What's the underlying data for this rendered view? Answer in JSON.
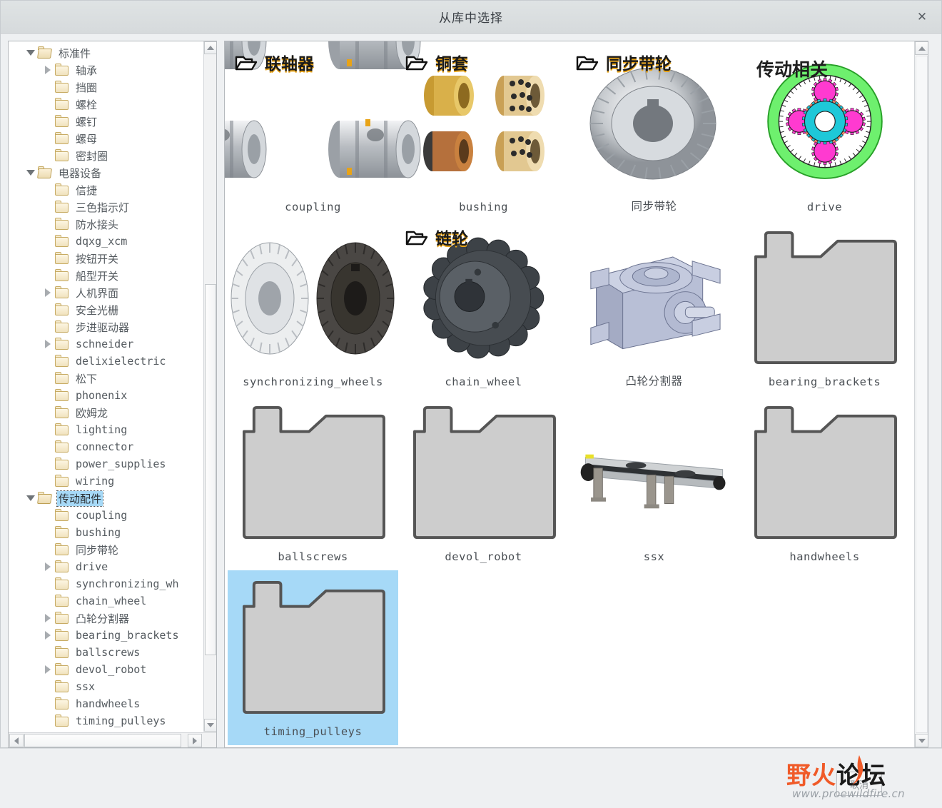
{
  "window": {
    "title": "从库中选择",
    "close_label": "✕"
  },
  "tree": {
    "items": [
      {
        "label": "标准件",
        "indent": 0,
        "twisty": "down",
        "folder": "open",
        "selected": false
      },
      {
        "label": "轴承",
        "indent": 1,
        "twisty": "right",
        "folder": "closed",
        "selected": false
      },
      {
        "label": "挡圈",
        "indent": 1,
        "twisty": "none",
        "folder": "closed",
        "selected": false
      },
      {
        "label": "螺栓",
        "indent": 1,
        "twisty": "none",
        "folder": "closed",
        "selected": false
      },
      {
        "label": "螺钉",
        "indent": 1,
        "twisty": "none",
        "folder": "closed",
        "selected": false
      },
      {
        "label": "螺母",
        "indent": 1,
        "twisty": "none",
        "folder": "closed",
        "selected": false
      },
      {
        "label": "密封圈",
        "indent": 1,
        "twisty": "none",
        "folder": "closed",
        "selected": false
      },
      {
        "label": "电器设备",
        "indent": 0,
        "twisty": "down",
        "folder": "open",
        "selected": false
      },
      {
        "label": "信捷",
        "indent": 1,
        "twisty": "none",
        "folder": "closed",
        "selected": false
      },
      {
        "label": "三色指示灯",
        "indent": 1,
        "twisty": "none",
        "folder": "closed",
        "selected": false
      },
      {
        "label": "防水接头",
        "indent": 1,
        "twisty": "none",
        "folder": "closed",
        "selected": false
      },
      {
        "label": "dqxg_xcm",
        "indent": 1,
        "twisty": "none",
        "folder": "closed",
        "selected": false
      },
      {
        "label": "按钮开关",
        "indent": 1,
        "twisty": "none",
        "folder": "closed",
        "selected": false
      },
      {
        "label": "船型开关",
        "indent": 1,
        "twisty": "none",
        "folder": "closed",
        "selected": false
      },
      {
        "label": "人机界面",
        "indent": 1,
        "twisty": "right",
        "folder": "closed",
        "selected": false
      },
      {
        "label": "安全光栅",
        "indent": 1,
        "twisty": "none",
        "folder": "closed",
        "selected": false
      },
      {
        "label": "步进驱动器",
        "indent": 1,
        "twisty": "none",
        "folder": "closed",
        "selected": false
      },
      {
        "label": "schneider",
        "indent": 1,
        "twisty": "right",
        "folder": "closed",
        "selected": false
      },
      {
        "label": "delixielectric",
        "indent": 1,
        "twisty": "none",
        "folder": "closed",
        "selected": false
      },
      {
        "label": "松下",
        "indent": 1,
        "twisty": "none",
        "folder": "closed",
        "selected": false
      },
      {
        "label": "phonenix",
        "indent": 1,
        "twisty": "none",
        "folder": "closed",
        "selected": false
      },
      {
        "label": "欧姆龙",
        "indent": 1,
        "twisty": "none",
        "folder": "closed",
        "selected": false
      },
      {
        "label": "lighting",
        "indent": 1,
        "twisty": "none",
        "folder": "closed",
        "selected": false
      },
      {
        "label": "connector",
        "indent": 1,
        "twisty": "none",
        "folder": "closed",
        "selected": false
      },
      {
        "label": "power_supplies",
        "indent": 1,
        "twisty": "none",
        "folder": "closed",
        "selected": false
      },
      {
        "label": "wiring",
        "indent": 1,
        "twisty": "none",
        "folder": "closed",
        "selected": false
      },
      {
        "label": "传动配件",
        "indent": 0,
        "twisty": "down",
        "folder": "open",
        "selected": true
      },
      {
        "label": "coupling",
        "indent": 1,
        "twisty": "none",
        "folder": "closed",
        "selected": false
      },
      {
        "label": "bushing",
        "indent": 1,
        "twisty": "none",
        "folder": "closed",
        "selected": false
      },
      {
        "label": "同步带轮",
        "indent": 1,
        "twisty": "none",
        "folder": "closed",
        "selected": false
      },
      {
        "label": "drive",
        "indent": 1,
        "twisty": "right",
        "folder": "closed",
        "selected": false
      },
      {
        "label": "synchronizing_wh",
        "indent": 1,
        "twisty": "none",
        "folder": "closed",
        "selected": false
      },
      {
        "label": "chain_wheel",
        "indent": 1,
        "twisty": "none",
        "folder": "closed",
        "selected": false
      },
      {
        "label": "凸轮分割器",
        "indent": 1,
        "twisty": "right",
        "folder": "closed",
        "selected": false
      },
      {
        "label": "bearing_brackets",
        "indent": 1,
        "twisty": "right",
        "folder": "closed",
        "selected": false
      },
      {
        "label": "ballscrews",
        "indent": 1,
        "twisty": "none",
        "folder": "closed",
        "selected": false
      },
      {
        "label": "devol_robot",
        "indent": 1,
        "twisty": "right",
        "folder": "closed",
        "selected": false
      },
      {
        "label": "ssx",
        "indent": 1,
        "twisty": "none",
        "folder": "closed",
        "selected": false
      },
      {
        "label": "handwheels",
        "indent": 1,
        "twisty": "none",
        "folder": "closed",
        "selected": false
      },
      {
        "label": "timing_pulleys",
        "indent": 1,
        "twisty": "none",
        "folder": "closed",
        "selected": false
      }
    ]
  },
  "grid": {
    "cells": [
      {
        "caption": "coupling",
        "thumb": "coupling",
        "group_header": "联轴器",
        "selected": false
      },
      {
        "caption": "bushing",
        "thumb": "bushing",
        "group_header": "铜套",
        "selected": false
      },
      {
        "caption": "同步带轮",
        "thumb": "timing-belt-pulley",
        "group_header": "同步带轮",
        "selected": false
      },
      {
        "caption": "drive",
        "thumb": "planetary-gear",
        "group_header": "",
        "overlay_title": "传动相关",
        "selected": false
      },
      {
        "caption": "synchronizing_wheels",
        "thumb": "sync-wheels",
        "group_header": "",
        "selected": false
      },
      {
        "caption": "chain_wheel",
        "thumb": "sprocket",
        "group_header": "链轮",
        "selected": false
      },
      {
        "caption": "凸轮分割器",
        "thumb": "cam-indexer",
        "group_header": "",
        "selected": false
      },
      {
        "caption": "bearing_brackets",
        "thumb": "folder-placeholder",
        "group_header": "",
        "selected": false
      },
      {
        "caption": "ballscrews",
        "thumb": "folder-placeholder",
        "group_header": "",
        "selected": false
      },
      {
        "caption": "devol_robot",
        "thumb": "folder-placeholder",
        "group_header": "",
        "selected": false
      },
      {
        "caption": "ssx",
        "thumb": "conveyor",
        "group_header": "",
        "selected": false
      },
      {
        "caption": "handwheels",
        "thumb": "folder-placeholder",
        "group_header": "",
        "selected": false
      },
      {
        "caption": "timing_pulleys",
        "thumb": "folder-placeholder",
        "group_header": "",
        "selected": true
      }
    ]
  },
  "footer": {
    "ghost_button_label": "取消",
    "watermark_brand_1": "野",
    "watermark_brand_2": "火",
    "watermark_brand_3": "论坛",
    "watermark_url": "www.proewildfire.cn"
  },
  "colors": {
    "selection_blue": "#a6d9f7",
    "accent_orange": "#f05a28",
    "header_gold": "#e8a317",
    "placeholder_gray": "#cdcdcd",
    "placeholder_outline": "#555555"
  }
}
